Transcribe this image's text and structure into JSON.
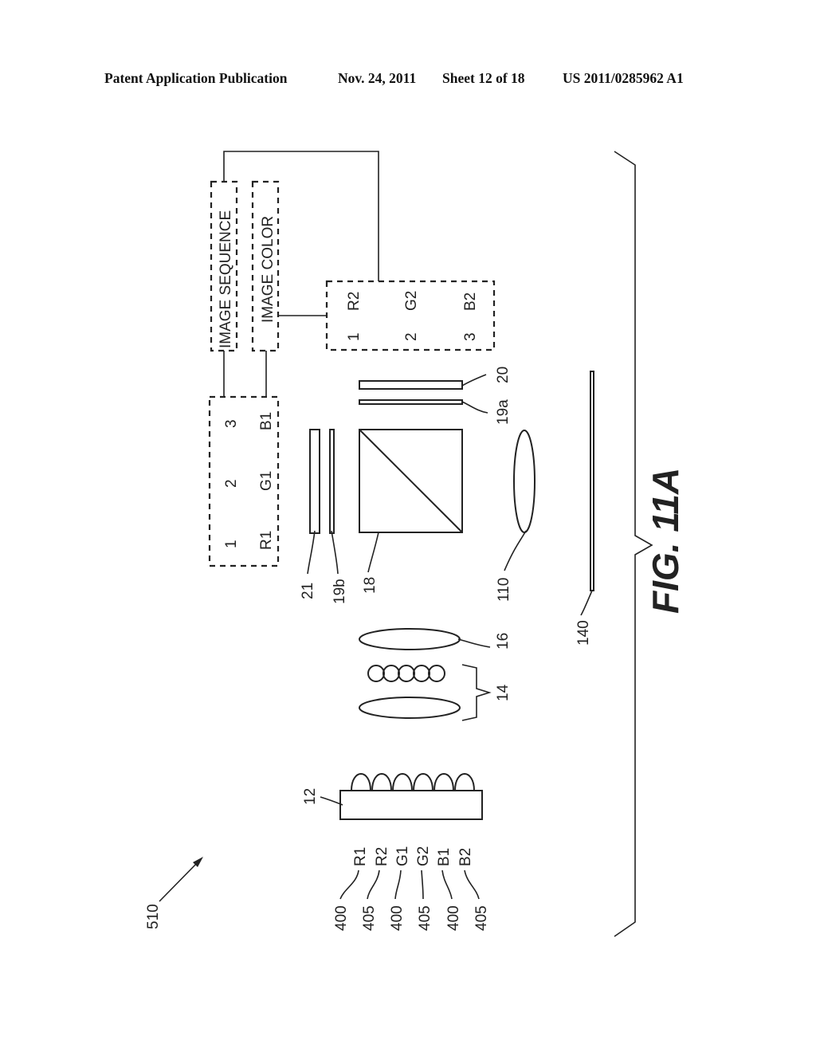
{
  "header": {
    "title": "Patent Application Publication",
    "date": "Nov. 24, 2011",
    "sheet": "Sheet 12 of 18",
    "number": "US 2011/0285962 A1"
  },
  "figure": {
    "label": "FIG. 11A",
    "system_ref": "510",
    "control_boxes": {
      "image_sequence": "IMAGE SEQUENCE",
      "image_color": "IMAGE COLOR"
    },
    "first_selector": {
      "slots": [
        "1",
        "2",
        "3"
      ],
      "colors": [
        "R1",
        "G1",
        "B1"
      ]
    },
    "second_selector": {
      "slots": [
        "1",
        "2",
        "3"
      ],
      "colors": [
        "R2",
        "G2",
        "B2"
      ]
    },
    "components": {
      "led_array": "12",
      "lens_group": "14",
      "condenser_lens": "16",
      "beam_splitter": "18",
      "polarizer_a": "19a",
      "polarizer_b": "19b",
      "display_a": "20",
      "display_b": "21",
      "projection_lens": "110",
      "screen": "140"
    },
    "leds": [
      {
        "color": "R1",
        "ref": "400"
      },
      {
        "color": "R2",
        "ref": "405"
      },
      {
        "color": "G1",
        "ref": "400"
      },
      {
        "color": "G2",
        "ref": "405"
      },
      {
        "color": "B1",
        "ref": "400"
      },
      {
        "color": "B2",
        "ref": "405"
      }
    ]
  }
}
